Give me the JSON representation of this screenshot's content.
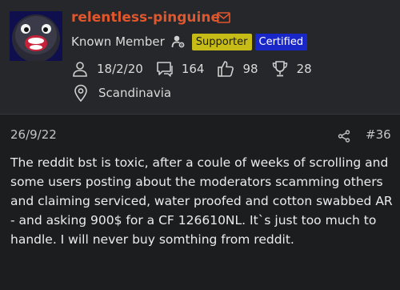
{
  "user": {
    "username": "relentless-pinguine",
    "member_title": "Known Member",
    "badges": [
      {
        "label": "Supporter",
        "color": "#c7bc17"
      },
      {
        "label": "Certified",
        "color": "#1926c8"
      }
    ],
    "icons": {
      "mail": "mail-icon",
      "staff": "user-gear-icon",
      "joined": "person-icon",
      "messages": "chat-bubble-icon",
      "reactions": "thumbs-up-icon",
      "trophies": "trophy-icon",
      "location": "map-pin-icon"
    },
    "stats": {
      "joined": "18/2/20",
      "messages": "164",
      "reactions": "98",
      "trophies": "28"
    },
    "location": "Scandinavia"
  },
  "post": {
    "date": "26/9/22",
    "number": "#36",
    "body": "The reddit bst is toxic, after a coule of weeks of scrolling and some users posting about the moderators scamming others and claiming serviced, water proofed and cotton swabbed AR - and asking 900$ for a CF 126610NL. It`s just too much to handle. I will never buy somthing from reddit."
  },
  "colors": {
    "username": "#e0562d",
    "header_bg": "#25272a",
    "page_bg": "#1c1d1f"
  }
}
